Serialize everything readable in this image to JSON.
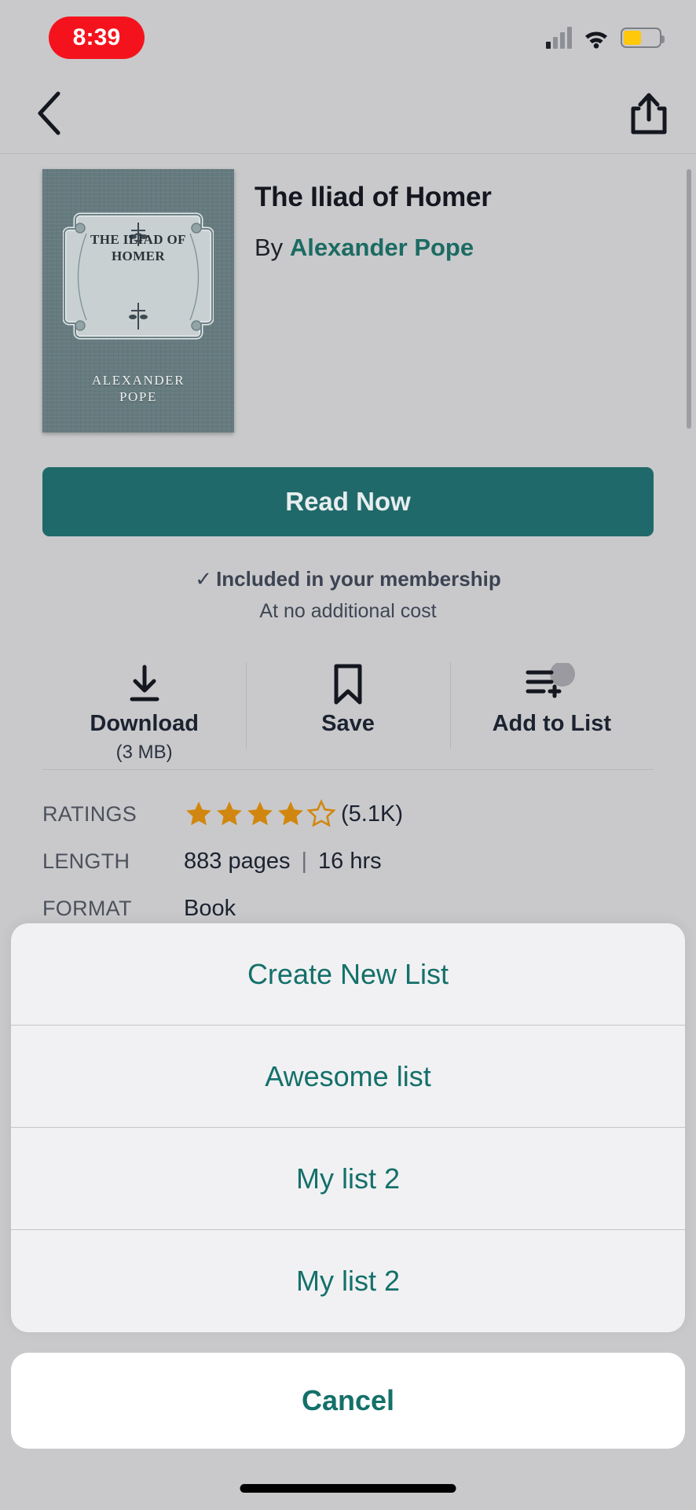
{
  "status_bar": {
    "time": "8:39",
    "signal_icon": "cellular-signal-icon",
    "wifi_icon": "wifi-icon",
    "battery_icon": "battery-low-power-icon"
  },
  "nav": {
    "back_icon": "chevron-left-icon",
    "share_icon": "share-upload-icon"
  },
  "book": {
    "title": "The Iliad of Homer",
    "by_label": "By",
    "author": "Alexander Pope",
    "cover": {
      "title": "THE ILIAD OF\nHOMER",
      "author": "ALEXANDER\nPOPE",
      "background_color": "#667b7f",
      "plaque_color": "#c3cbcd"
    }
  },
  "primary_action": {
    "read_now_label": "Read Now",
    "color": "#20696a"
  },
  "membership": {
    "check_icon": "check-icon",
    "included_text": "Included in your membership",
    "subtext": "At no additional cost"
  },
  "actions": [
    {
      "icon": "download-icon",
      "label": "Download",
      "sub": "(3 MB)"
    },
    {
      "icon": "bookmark-icon",
      "label": "Save",
      "sub": ""
    },
    {
      "icon": "add-to-list-icon",
      "label": "Add to List",
      "sub": ""
    }
  ],
  "details": {
    "ratings_label": "RATINGS",
    "ratings_stars_filled": 4,
    "ratings_stars_total": 5,
    "ratings_count": "(5.1K)",
    "star_color": "#d1870f",
    "length_label": "LENGTH",
    "length_pages": "883 pages",
    "length_separator": "|",
    "length_time": "16 hrs",
    "format_label": "FORMAT",
    "format_value": "Book"
  },
  "action_sheet": {
    "items": [
      {
        "label": "Create New List"
      },
      {
        "label": "Awesome list"
      },
      {
        "label": "My list 2"
      },
      {
        "label": "My list 2"
      }
    ],
    "cancel_label": "Cancel",
    "accent_color": "#14706a"
  }
}
